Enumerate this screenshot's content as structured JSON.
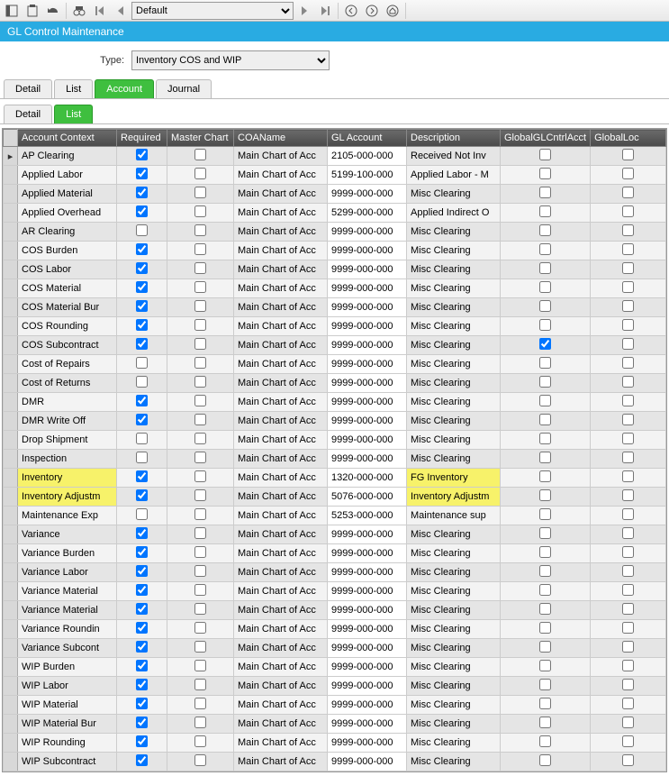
{
  "toolbar": {
    "view_select": "Default"
  },
  "title": "GL Control Maintenance",
  "form": {
    "type_label": "Type:",
    "type_value": "Inventory COS and WIP"
  },
  "tabs1": {
    "detail": "Detail",
    "list": "List",
    "account": "Account",
    "journal": "Journal"
  },
  "tabs2": {
    "detail": "Detail",
    "list": "List"
  },
  "headers": {
    "context": "Account Context",
    "required": "Required",
    "master": "Master Chart",
    "coaname": "COAName",
    "glacct": "GL Account",
    "desc": "Description",
    "globalacct": "GlobalGLCntrlAcct",
    "globallock": "GlobalLoc"
  },
  "highlight_rows": [
    17,
    18
  ],
  "highlight_desc_rows": [
    17,
    18
  ],
  "rows": [
    {
      "ctx": "AP Clearing",
      "req": true,
      "mc": false,
      "coa": "Main Chart of Acc",
      "gl": "2105-000-000",
      "desc": "Received Not Inv",
      "gg": false,
      "gc": false
    },
    {
      "ctx": "Applied Labor",
      "req": true,
      "mc": false,
      "coa": "Main Chart of Acc",
      "gl": "5199-100-000",
      "desc": "Applied Labor - M",
      "gg": false,
      "gc": false
    },
    {
      "ctx": "Applied Material",
      "req": true,
      "mc": false,
      "coa": "Main Chart of Acc",
      "gl": "9999-000-000",
      "desc": "Misc Clearing",
      "gg": false,
      "gc": false
    },
    {
      "ctx": "Applied Overhead",
      "req": true,
      "mc": false,
      "coa": "Main Chart of Acc",
      "gl": "5299-000-000",
      "desc": "Applied Indirect O",
      "gg": false,
      "gc": false
    },
    {
      "ctx": "AR Clearing",
      "req": false,
      "mc": false,
      "coa": "Main Chart of Acc",
      "gl": "9999-000-000",
      "desc": "Misc Clearing",
      "gg": false,
      "gc": false
    },
    {
      "ctx": "COS Burden",
      "req": true,
      "mc": false,
      "coa": "Main Chart of Acc",
      "gl": "9999-000-000",
      "desc": "Misc Clearing",
      "gg": false,
      "gc": false
    },
    {
      "ctx": "COS Labor",
      "req": true,
      "mc": false,
      "coa": "Main Chart of Acc",
      "gl": "9999-000-000",
      "desc": "Misc Clearing",
      "gg": false,
      "gc": false
    },
    {
      "ctx": "COS Material",
      "req": true,
      "mc": false,
      "coa": "Main Chart of Acc",
      "gl": "9999-000-000",
      "desc": "Misc Clearing",
      "gg": false,
      "gc": false
    },
    {
      "ctx": "COS Material Bur",
      "req": true,
      "mc": false,
      "coa": "Main Chart of Acc",
      "gl": "9999-000-000",
      "desc": "Misc Clearing",
      "gg": false,
      "gc": false
    },
    {
      "ctx": "COS Rounding",
      "req": true,
      "mc": false,
      "coa": "Main Chart of Acc",
      "gl": "9999-000-000",
      "desc": "Misc Clearing",
      "gg": false,
      "gc": false
    },
    {
      "ctx": "COS Subcontract",
      "req": true,
      "mc": false,
      "coa": "Main Chart of Acc",
      "gl": "9999-000-000",
      "desc": "Misc Clearing",
      "gg": true,
      "gc": false
    },
    {
      "ctx": "Cost of Repairs",
      "req": false,
      "mc": false,
      "coa": "Main Chart of Acc",
      "gl": "9999-000-000",
      "desc": "Misc Clearing",
      "gg": false,
      "gc": false
    },
    {
      "ctx": "Cost of Returns",
      "req": false,
      "mc": false,
      "coa": "Main Chart of Acc",
      "gl": "9999-000-000",
      "desc": "Misc Clearing",
      "gg": false,
      "gc": false
    },
    {
      "ctx": "DMR",
      "req": true,
      "mc": false,
      "coa": "Main Chart of Acc",
      "gl": "9999-000-000",
      "desc": "Misc Clearing",
      "gg": false,
      "gc": false
    },
    {
      "ctx": "DMR Write Off",
      "req": true,
      "mc": false,
      "coa": "Main Chart of Acc",
      "gl": "9999-000-000",
      "desc": "Misc Clearing",
      "gg": false,
      "gc": false
    },
    {
      "ctx": "Drop Shipment",
      "req": false,
      "mc": false,
      "coa": "Main Chart of Acc",
      "gl": "9999-000-000",
      "desc": "Misc Clearing",
      "gg": false,
      "gc": false
    },
    {
      "ctx": "Inspection",
      "req": false,
      "mc": false,
      "coa": "Main Chart of Acc",
      "gl": "9999-000-000",
      "desc": "Misc Clearing",
      "gg": false,
      "gc": false
    },
    {
      "ctx": "Inventory",
      "req": true,
      "mc": false,
      "coa": "Main Chart of Acc",
      "gl": "1320-000-000",
      "desc": "FG Inventory",
      "gg": false,
      "gc": false
    },
    {
      "ctx": "Inventory Adjustm",
      "req": true,
      "mc": false,
      "coa": "Main Chart of Acc",
      "gl": "5076-000-000",
      "desc": "Inventory Adjustm",
      "gg": false,
      "gc": false
    },
    {
      "ctx": "Maintenance Exp",
      "req": false,
      "mc": false,
      "coa": "Main Chart of Acc",
      "gl": "5253-000-000",
      "desc": "Maintenance sup",
      "gg": false,
      "gc": false
    },
    {
      "ctx": "Variance",
      "req": true,
      "mc": false,
      "coa": "Main Chart of Acc",
      "gl": "9999-000-000",
      "desc": "Misc Clearing",
      "gg": false,
      "gc": false
    },
    {
      "ctx": "Variance Burden",
      "req": true,
      "mc": false,
      "coa": "Main Chart of Acc",
      "gl": "9999-000-000",
      "desc": "Misc Clearing",
      "gg": false,
      "gc": false
    },
    {
      "ctx": "Variance Labor",
      "req": true,
      "mc": false,
      "coa": "Main Chart of Acc",
      "gl": "9999-000-000",
      "desc": "Misc Clearing",
      "gg": false,
      "gc": false
    },
    {
      "ctx": "Variance Material",
      "req": true,
      "mc": false,
      "coa": "Main Chart of Acc",
      "gl": "9999-000-000",
      "desc": "Misc Clearing",
      "gg": false,
      "gc": false
    },
    {
      "ctx": "Variance Material",
      "req": true,
      "mc": false,
      "coa": "Main Chart of Acc",
      "gl": "9999-000-000",
      "desc": "Misc Clearing",
      "gg": false,
      "gc": false
    },
    {
      "ctx": "Variance Roundin",
      "req": true,
      "mc": false,
      "coa": "Main Chart of Acc",
      "gl": "9999-000-000",
      "desc": "Misc Clearing",
      "gg": false,
      "gc": false
    },
    {
      "ctx": "Variance Subcont",
      "req": true,
      "mc": false,
      "coa": "Main Chart of Acc",
      "gl": "9999-000-000",
      "desc": "Misc Clearing",
      "gg": false,
      "gc": false
    },
    {
      "ctx": "WIP Burden",
      "req": true,
      "mc": false,
      "coa": "Main Chart of Acc",
      "gl": "9999-000-000",
      "desc": "Misc Clearing",
      "gg": false,
      "gc": false
    },
    {
      "ctx": "WIP Labor",
      "req": true,
      "mc": false,
      "coa": "Main Chart of Acc",
      "gl": "9999-000-000",
      "desc": "Misc Clearing",
      "gg": false,
      "gc": false
    },
    {
      "ctx": "WIP Material",
      "req": true,
      "mc": false,
      "coa": "Main Chart of Acc",
      "gl": "9999-000-000",
      "desc": "Misc Clearing",
      "gg": false,
      "gc": false
    },
    {
      "ctx": "WIP Material Bur",
      "req": true,
      "mc": false,
      "coa": "Main Chart of Acc",
      "gl": "9999-000-000",
      "desc": "Misc Clearing",
      "gg": false,
      "gc": false
    },
    {
      "ctx": "WIP Rounding",
      "req": true,
      "mc": false,
      "coa": "Main Chart of Acc",
      "gl": "9999-000-000",
      "desc": "Misc Clearing",
      "gg": false,
      "gc": false
    },
    {
      "ctx": "WIP Subcontract",
      "req": true,
      "mc": false,
      "coa": "Main Chart of Acc",
      "gl": "9999-000-000",
      "desc": "Misc Clearing",
      "gg": false,
      "gc": false
    }
  ]
}
